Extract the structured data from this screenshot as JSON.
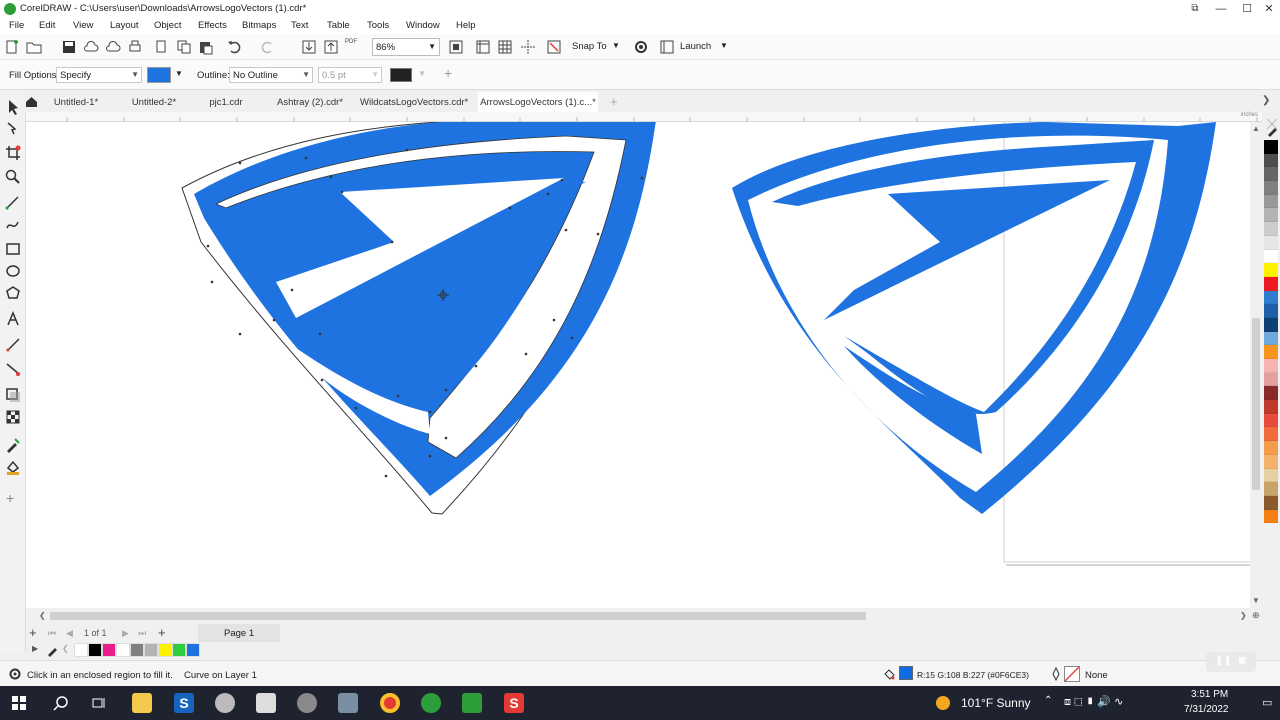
{
  "window": {
    "title": "CorelDRAW - C:\\Users\\user\\Downloads\\ArrowsLogoVectors (1).cdr*",
    "controls": {
      "minimize": "—",
      "maximize": "☐",
      "close": "✕"
    }
  },
  "menu": [
    "File",
    "Edit",
    "View",
    "Layout",
    "Object",
    "Effects",
    "Bitmaps",
    "Text",
    "Table",
    "Tools",
    "Window",
    "Help"
  ],
  "toolbar": {
    "zoom": "86%",
    "snap_to": "Snap To",
    "launch": "Launch",
    "pdf": "PDF"
  },
  "property_bar": {
    "fill_options_label": "Fill Options:",
    "fill_options_value": "Specify",
    "fill_color": "#1E73E0",
    "outline_label": "Outline:",
    "outline_value": "No Outline",
    "outline_width": "0.5 pt",
    "outline_color": "#222222"
  },
  "tabs": [
    {
      "label": "Untitled-1*",
      "active": false
    },
    {
      "label": "Untitled-2*",
      "active": false
    },
    {
      "label": "pjc1.cdr",
      "active": false
    },
    {
      "label": "Ashtray (2).cdr*",
      "active": false
    },
    {
      "label": "WildcatsLogoVectors.cdr*",
      "active": false
    },
    {
      "label": "ArrowsLogoVectors (1).c...*",
      "active": true
    }
  ],
  "ruler": {
    "unit": "inches"
  },
  "page_nav": {
    "counter": "1 of 1",
    "page_label": "Page 1"
  },
  "status": {
    "hint": "Click in an enclosed region to fill it.",
    "object": "Curve on Layer 1",
    "color_readout": "R:15 G:108 B:227 (#0F6CE3)",
    "outline_readout": "None",
    "fill_swatch": "#0F6CE3"
  },
  "taskbar": {
    "weather": "101°F  Sunny",
    "time": "3:51 PM",
    "date": "7/31/2022"
  },
  "colors": {
    "logo_blue": "#1E73E0",
    "palette": [
      "#000000",
      "#4d4d4d",
      "#666666",
      "#808080",
      "#999999",
      "#b3b3b3",
      "#cccccc",
      "#e6e6e6",
      "#ffffff",
      "#fff200",
      "#ed1c24",
      "#2e7dd1",
      "#1d5fa8",
      "#0f3f73",
      "#6fa8dc",
      "#f7941d",
      "#f6b3b3",
      "#e2a0a0",
      "#8b2a2a",
      "#c0392b",
      "#e84c3d",
      "#f26b3a",
      "#f39c4a",
      "#f5b26b",
      "#e6cfa0",
      "#c9a46a",
      "#8a5a2b",
      "#f57f17"
    ],
    "doc_palette": [
      "#ffffff",
      "#000000",
      "#e91e8c",
      "#ffffff",
      "#808080",
      "#b3b3b3",
      "#fff200",
      "#2ecc40",
      "#1E73E0"
    ]
  }
}
